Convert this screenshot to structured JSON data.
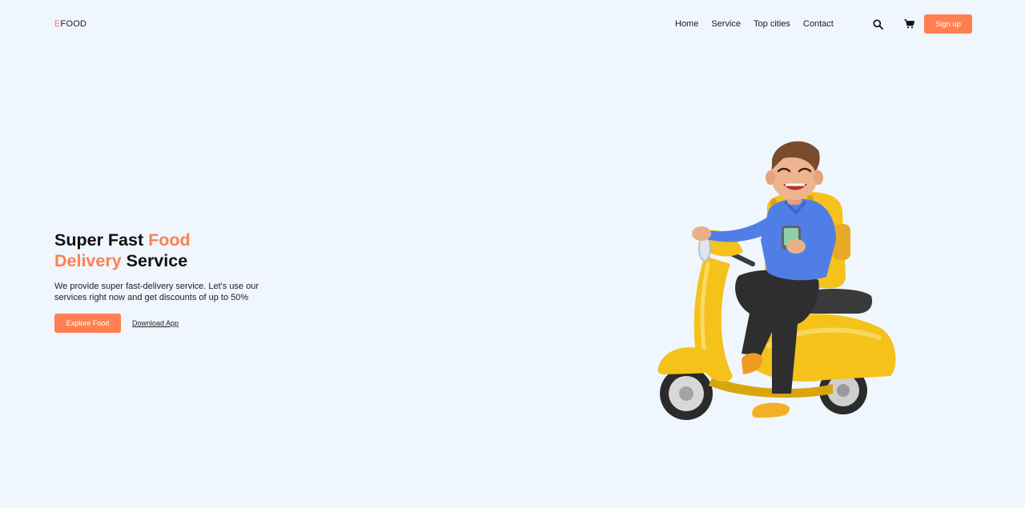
{
  "header": {
    "logo_accent": "E",
    "logo_rest": "FOOD",
    "nav": [
      "Home",
      "Service",
      "Top cities",
      "Contact"
    ],
    "search_icon": "search-icon",
    "cart_icon": "cart-icon",
    "signup_label": "Sign up"
  },
  "hero": {
    "title_part1": "Super Fast ",
    "title_accent1": "Food",
    "title_accent2": "Delivery",
    "title_part2": " Service",
    "description": "We provide super fast-delivery service. Let's use our services right now and get discounts of up to 50%",
    "primary_cta": "Explore Food",
    "secondary_cta": "Download App"
  },
  "colors": {
    "accent": "#ff7f50",
    "background": "#eff6fd",
    "text": "#1b1b1b",
    "scooter": "#f5c21b"
  }
}
